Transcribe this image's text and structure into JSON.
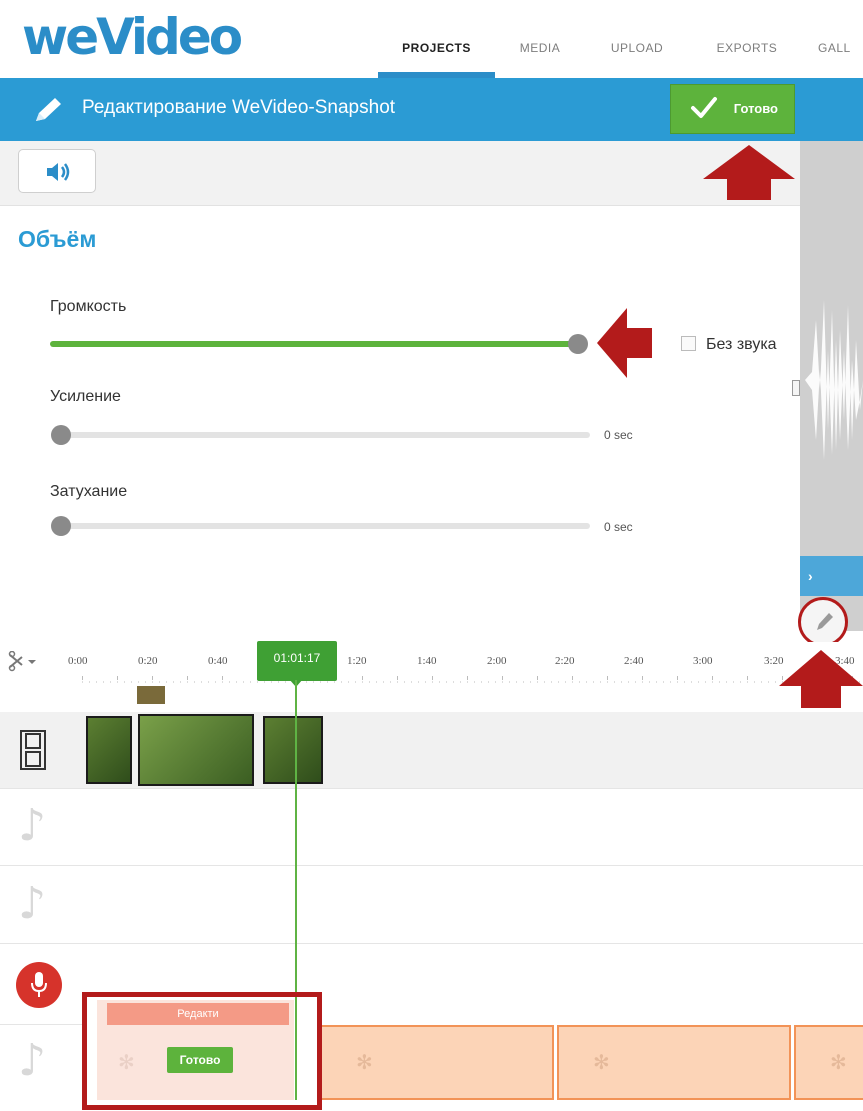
{
  "brand": {
    "logo": "weVideo"
  },
  "nav": {
    "tabs": [
      {
        "label": "PROJECTS",
        "active": true
      },
      {
        "label": "MEDIA"
      },
      {
        "label": "UPLOAD"
      },
      {
        "label": "EXPORTS"
      },
      {
        "label": "GALL"
      }
    ]
  },
  "header": {
    "title": "Редактирование WeVideo-Snapshot",
    "done_label": "Готово"
  },
  "panel": {
    "title": "Объём",
    "volume": {
      "label": "Громкость",
      "level": 1.0
    },
    "mute": {
      "label": "Без звука",
      "checked": false
    },
    "fade_in": {
      "label": "Усиление",
      "value": "0 sec",
      "level": 0
    },
    "fade_out": {
      "label": "Затухание",
      "value": "0 sec",
      "level": 0
    }
  },
  "timeline": {
    "playhead": "01:01:17",
    "ticks": [
      "0:00",
      "0:20",
      "0:40",
      "1:20",
      "1:40",
      "2:00",
      "2:20",
      "2:40",
      "3:00",
      "3:20",
      "3:40"
    ],
    "edit_clip_label": "Редакти",
    "edit_clip_done": "Готово"
  },
  "colors": {
    "accent_blue": "#2b9bd4",
    "done_green": "#5db33c",
    "annotation_red": "#b31b1b"
  },
  "icons": [
    "pencil-icon",
    "check-icon",
    "speaker-icon",
    "scissors-icon",
    "film-icon",
    "music-note-icon",
    "microphone-icon",
    "spinner-icon"
  ]
}
